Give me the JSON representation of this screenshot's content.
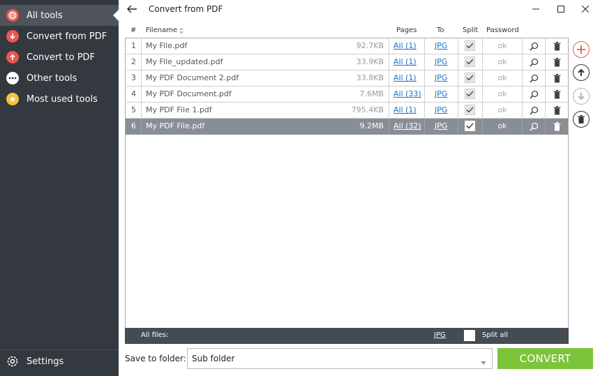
{
  "sidebar": {
    "items": [
      {
        "label": "All tools",
        "icon": "target-icon",
        "color": "#e9574e"
      },
      {
        "label": "Convert from PDF",
        "icon": "arrow-down-icon",
        "color": "#e9574e"
      },
      {
        "label": "Convert to PDF",
        "icon": "arrow-up-icon",
        "color": "#e9574e"
      },
      {
        "label": "Other tools",
        "icon": "dots-icon",
        "color": "#ffffff"
      },
      {
        "label": "Most used tools",
        "icon": "star-icon",
        "color": "#f6c23e"
      }
    ],
    "settings_label": "Settings"
  },
  "titlebar": {
    "title": "Convert from PDF"
  },
  "table": {
    "headers": {
      "num": "#",
      "filename": "Filename",
      "pages": "Pages",
      "to": "To",
      "split": "Split",
      "password": "Password"
    },
    "rows": [
      {
        "num": "1",
        "filename": "My File.pdf",
        "size": "92.7KB",
        "pages": "All (1)",
        "to": "JPG",
        "split": true,
        "password": "ok"
      },
      {
        "num": "2",
        "filename": "My File_updated.pdf",
        "size": "33.9KB",
        "pages": "All (1)",
        "to": "JPG",
        "split": true,
        "password": "ok"
      },
      {
        "num": "3",
        "filename": "My PDF Document 2.pdf",
        "size": "33.8KB",
        "pages": "All (1)",
        "to": "JPG",
        "split": true,
        "password": "ok"
      },
      {
        "num": "4",
        "filename": "My PDF Document.pdf",
        "size": "7.6MB",
        "pages": "All (33)",
        "to": "JPG",
        "split": true,
        "password": "ok"
      },
      {
        "num": "5",
        "filename": "My PDF File 1.pdf",
        "size": "795.4KB",
        "pages": "All (1)",
        "to": "JPG",
        "split": true,
        "password": "ok"
      },
      {
        "num": "6",
        "filename": "My PDF File.pdf",
        "size": "9.2MB",
        "pages": "All (32)",
        "to": "JPG",
        "split": true,
        "password": "ok"
      }
    ],
    "selected_row": "6"
  },
  "all_files": {
    "label": "All files:",
    "to": "JPG",
    "split_all_label": "Split all"
  },
  "save": {
    "label": "Save to folder:",
    "value": "Sub folder"
  },
  "convert_label": "CONVERT",
  "colors": {
    "sidebar_bg": "#33393f",
    "accent_red": "#e9574e",
    "convert_green": "#7cc43a",
    "link_blue": "#1e73c8",
    "selected_row": "#888e94"
  }
}
